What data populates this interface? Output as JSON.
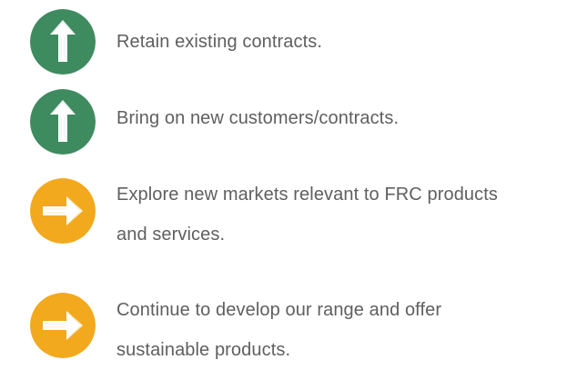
{
  "colors": {
    "green": "#3e8b5f",
    "amber": "#f2a91d",
    "text": "#5f5f5f",
    "white": "#ffffff"
  },
  "items": [
    {
      "icon": "up-arrow-icon",
      "color": "green",
      "lines": [
        "Retain existing contracts."
      ]
    },
    {
      "icon": "up-arrow-icon",
      "color": "green",
      "lines": [
        "Bring on new customers/contracts."
      ]
    },
    {
      "icon": "right-arrow-icon",
      "color": "amber",
      "lines": [
        "Explore new markets relevant to FRC products",
        "and services."
      ]
    },
    {
      "icon": "right-arrow-icon",
      "color": "amber",
      "lines": [
        "Continue to develop our range and offer",
        "sustainable products."
      ]
    }
  ]
}
